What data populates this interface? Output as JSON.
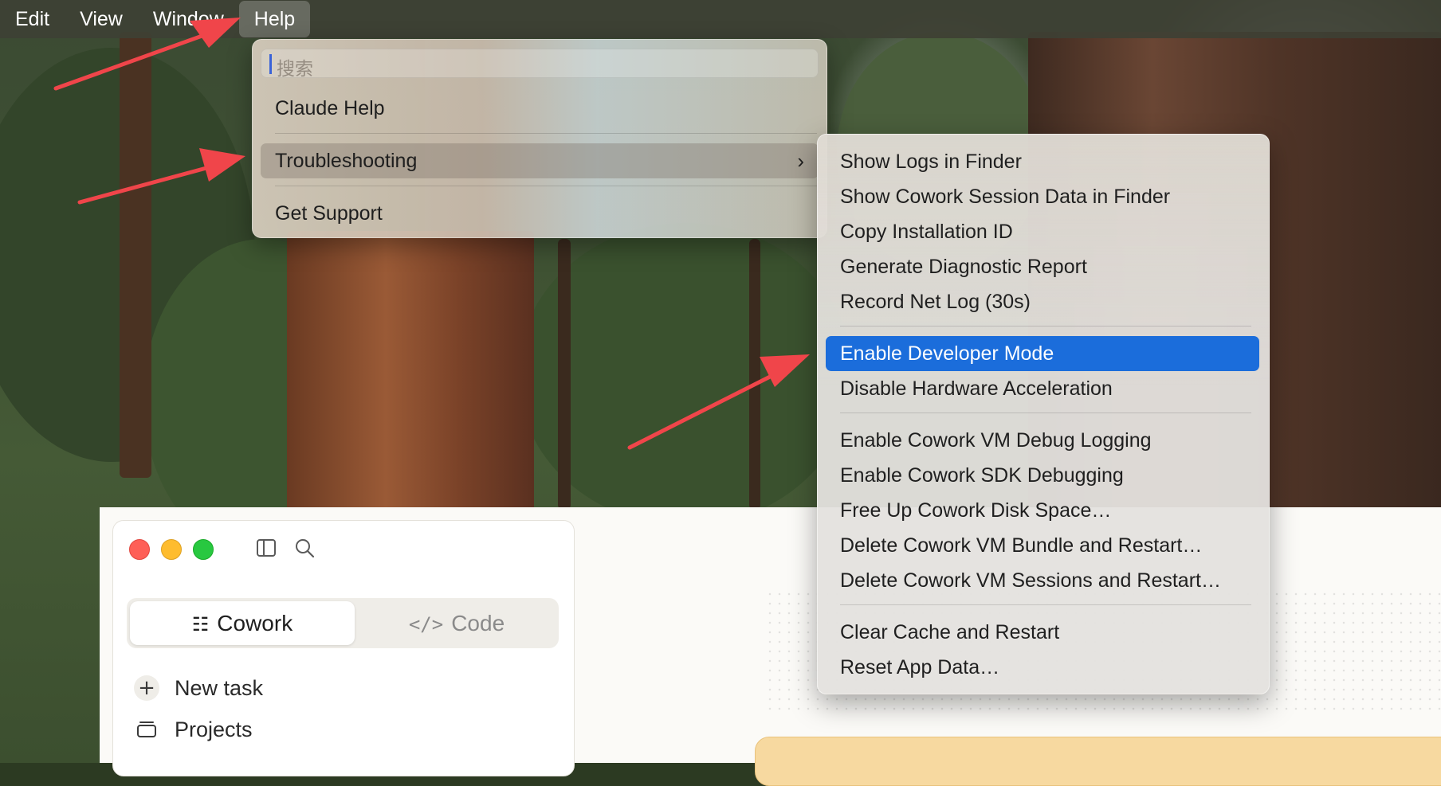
{
  "menubar": {
    "items": [
      {
        "label": "Edit"
      },
      {
        "label": "View"
      },
      {
        "label": "Window"
      },
      {
        "label": "Help"
      }
    ]
  },
  "help_menu": {
    "search_placeholder": "搜索",
    "items": [
      {
        "label": "Claude Help"
      },
      {
        "label": "Troubleshooting"
      },
      {
        "label": "Get Support"
      }
    ]
  },
  "troubleshooting_menu": {
    "items": [
      {
        "label": "Show Logs in Finder"
      },
      {
        "label": "Show Cowork Session Data in Finder"
      },
      {
        "label": "Copy Installation ID"
      },
      {
        "label": "Generate Diagnostic Report"
      },
      {
        "label": "Record Net Log (30s)"
      },
      {
        "label": "Enable Developer Mode",
        "selected": true
      },
      {
        "label": "Disable Hardware Acceleration"
      },
      {
        "label": "Enable Cowork VM Debug Logging"
      },
      {
        "label": "Enable Cowork SDK Debugging"
      },
      {
        "label": "Free Up Cowork Disk Space…"
      },
      {
        "label": "Delete Cowork VM Bundle and Restart…"
      },
      {
        "label": "Delete Cowork VM Sessions and Restart…"
      },
      {
        "label": "Clear Cache and Restart"
      },
      {
        "label": "Reset App Data…"
      }
    ]
  },
  "app": {
    "mode_tabs": [
      {
        "label": "Cowork",
        "icon": "checklist-icon",
        "active": true
      },
      {
        "label": "Code",
        "icon": "code-icon",
        "active": false
      }
    ],
    "nav": [
      {
        "label": "New task",
        "icon": "plus-icon"
      },
      {
        "label": "Projects",
        "icon": "folder-icon"
      }
    ]
  },
  "colors": {
    "selection": "#1b6ddb",
    "annotation_arrow": "#f0454a",
    "banner": "#f7d9a0"
  }
}
